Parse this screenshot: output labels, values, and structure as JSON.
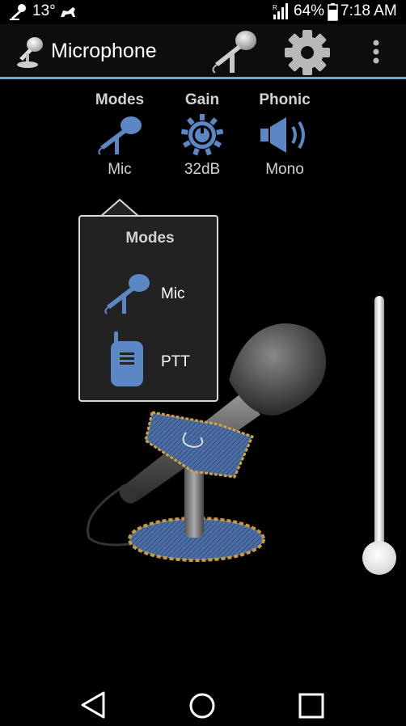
{
  "status_bar": {
    "temperature": "13°",
    "battery_percent": "64%",
    "time": "7:18 AM"
  },
  "action_bar": {
    "title": "Microphone",
    "accent_color": "#6fa8d8"
  },
  "controls": [
    {
      "label": "Modes",
      "value": "Mic",
      "icon": "microphone-icon"
    },
    {
      "label": "Gain",
      "value": "32dB",
      "icon": "gain-knob-icon"
    },
    {
      "label": "Phonic",
      "value": "Mono",
      "icon": "speaker-icon"
    }
  ],
  "modes_popup": {
    "title": "Modes",
    "items": [
      {
        "label": "Mic",
        "icon": "microphone-icon"
      },
      {
        "label": "PTT",
        "icon": "walkie-talkie-icon"
      }
    ]
  },
  "gain_slider": {
    "level": 0.0
  },
  "icon_color": "#5b87c4"
}
